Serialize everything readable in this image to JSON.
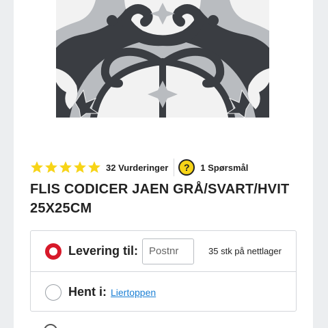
{
  "product": {
    "title_line1": "FLIS CODICER JAEN GRÅ/SVART/HVIT",
    "title_line2": "25X25CM",
    "rating": 5,
    "rating_count_label": "32 Vurderinger",
    "question_icon_glyph": "?",
    "question_count_label": "1 Spørsmål"
  },
  "delivery": {
    "options": [
      {
        "label": "Levering til:",
        "selected": true
      },
      {
        "label": "Hent i:",
        "selected": false
      }
    ],
    "postnr_placeholder": "Postnr",
    "postnr_value": "",
    "stock_text": "35 stk på nettlager",
    "store_link": "Liertoppen"
  },
  "colors": {
    "star": "#f7d417",
    "question_badge": "#f7d417",
    "radio_selected": "#d7192a",
    "link": "#1a7fd4",
    "tile_dark": "#3a3d42",
    "tile_light": "#b9bcc0",
    "tile_white": "#f2f2f2"
  },
  "icons": {
    "stars": "star-icon",
    "question": "question-icon"
  }
}
